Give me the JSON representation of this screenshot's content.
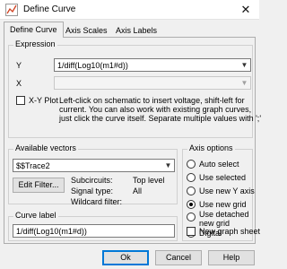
{
  "window": {
    "title": "Define Curve",
    "close_glyph": "✕"
  },
  "tabs": [
    {
      "label": "Define Curve",
      "active": true
    },
    {
      "label": "Axis Scales",
      "active": false
    },
    {
      "label": "Axis Labels",
      "active": false
    }
  ],
  "expression": {
    "group_title": "Expression",
    "y_label": "Y",
    "y_value": "1/diff(Log10(m1#d))",
    "x_label": "X",
    "x_value": "",
    "xy_plot_label": "X-Y Plot",
    "xy_plot_checked": false,
    "help_lines": [
      "Left-click on schematic to insert voltage, shift-left for",
      "current. You can also work with existing graph curves,",
      "just click the curve itself. Separate multiple values with ';'"
    ]
  },
  "vectors": {
    "group_title": "Available vectors",
    "selected": "$$Trace2",
    "edit_filter_label": "Edit Filter...",
    "subcircuits_label": "Subcircuits:",
    "subcircuits_value": "Top level",
    "signal_type_label": "Signal type:",
    "signal_type_value": "All",
    "wildcard_label": "Wildcard filter:",
    "wildcard_value": ""
  },
  "curve_label": {
    "group_title": "Curve label",
    "value": "1/diff(Log10(m1#d))"
  },
  "axis_options": {
    "group_title": "Axis options",
    "options": [
      {
        "label": "Auto select",
        "selected": false
      },
      {
        "label": "Use selected",
        "selected": false
      },
      {
        "label": "Use new Y axis",
        "selected": false
      },
      {
        "label": "Use new grid",
        "selected": true
      },
      {
        "label": "Use detached",
        "label2": "new grid",
        "selected": false
      },
      {
        "label": "Digital",
        "selected": false
      }
    ],
    "new_graph_sheet_label": "New graph sheet",
    "new_graph_sheet_checked": false
  },
  "buttons": {
    "ok": "Ok",
    "cancel": "Cancel",
    "help": "Help"
  },
  "colors": {
    "accent": "#0078d7",
    "window_bg": "#f0f0f0"
  },
  "icons": {
    "app": "define-curve-app-icon",
    "dropdown": "chevron-down-icon"
  }
}
